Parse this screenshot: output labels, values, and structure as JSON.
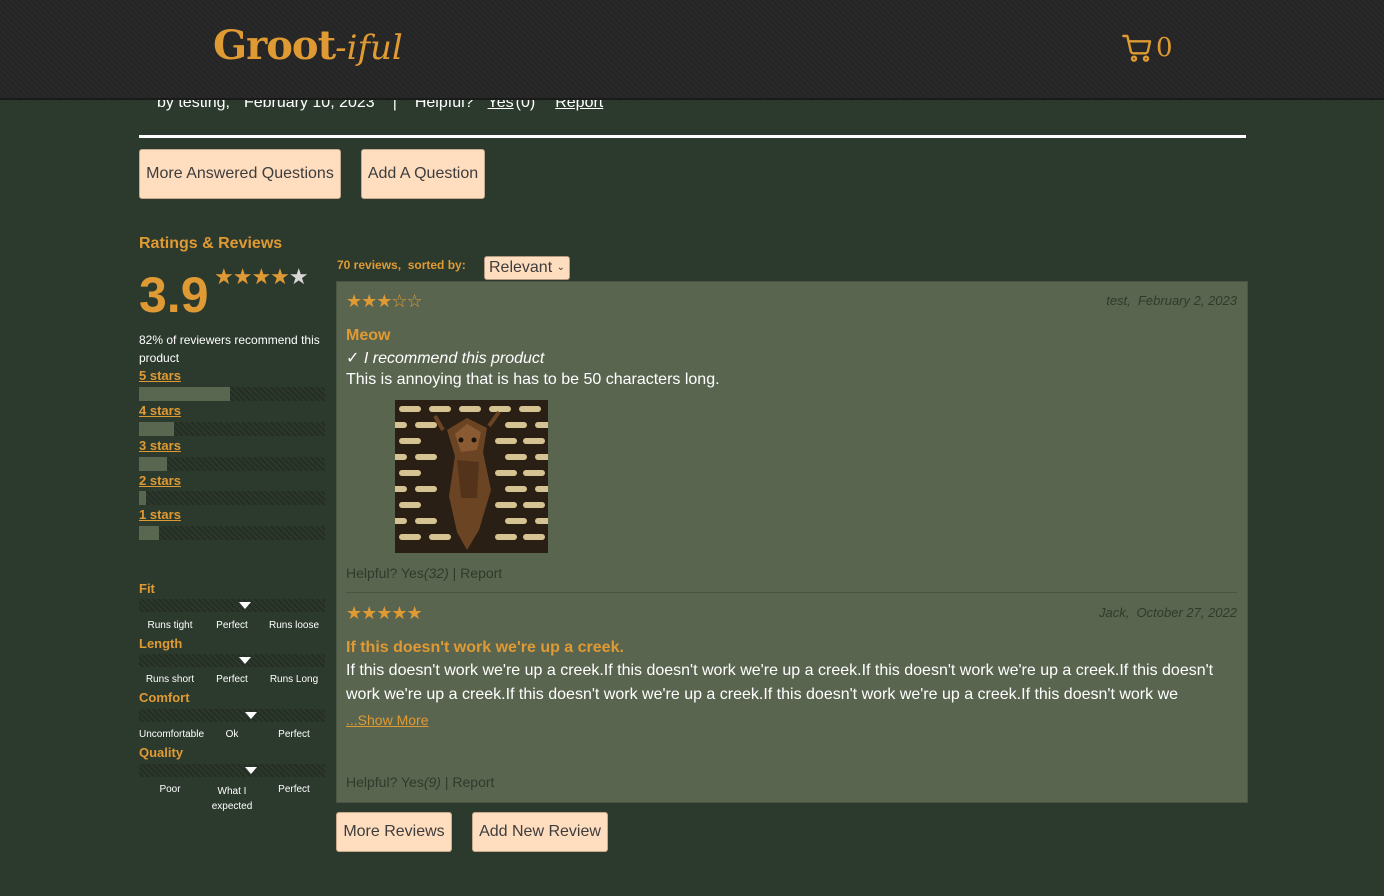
{
  "header": {
    "logo_main": "Groot",
    "logo_suffix": "-iful",
    "cart_count": "0"
  },
  "answer_meta": {
    "by": "by testing,",
    "date": "February 10, 2023",
    "sep": "|",
    "helpful": "Helpful?",
    "yes": "Yes",
    "yes_count": "(0)",
    "report": "Report"
  },
  "qa_buttons": {
    "more_questions": "More Answered Questions",
    "add_question": "Add A Question"
  },
  "ratings": {
    "heading": "Ratings & Reviews",
    "average": "3.9",
    "average_stars": "★★★★",
    "average_star_empty": "★",
    "recommend": "82% of reviewers recommend this product",
    "breakdown": [
      {
        "label": "5 stars",
        "fraction": 0.49
      },
      {
        "label": "4 stars",
        "fraction": 0.19
      },
      {
        "label": "3 stars",
        "fraction": 0.15
      },
      {
        "label": "2 stars",
        "fraction": 0.04
      },
      {
        "label": "1 stars",
        "fraction": 0.11
      }
    ]
  },
  "characteristics": [
    {
      "name": "Fit",
      "value": 0.57,
      "scale": [
        "Runs tight",
        "Perfect",
        "Runs loose"
      ]
    },
    {
      "name": "Length",
      "value": 0.57,
      "scale": [
        "Runs short",
        "Perfect",
        "Runs Long"
      ]
    },
    {
      "name": "Comfort",
      "value": 0.6,
      "scale": [
        "Uncomfortable",
        "Ok",
        "Perfect"
      ]
    },
    {
      "name": "Quality",
      "value": 0.6,
      "scale": [
        "Poor",
        "What I expected",
        "Perfect"
      ]
    }
  ],
  "reviews_list": {
    "count_text": "70 reviews,  sorted by:",
    "sort_selected": "Relevant",
    "reviews": [
      {
        "stars": "★★★☆☆",
        "meta": "test,  February 2, 2023",
        "title": "Meow",
        "recommend": "✓ I recommend this product",
        "body": "This is annoying that is has to be 50 characters long.",
        "helpful": "Helpful? Yes",
        "helpful_count": "(32)",
        "report": " | Report"
      },
      {
        "stars": "★★★★★",
        "meta": "Jack,  October 27, 2022",
        "title": "If this doesn't work we're up a creek.",
        "body": "If this doesn't work we're up a creek.If this doesn't work we're up a creek.If this doesn't work we're up a creek.If this doesn't work we're up a creek.If this doesn't work we're up a creek.If this doesn't work we're up a creek.If this doesn't work we",
        "show_more": "...Show More",
        "helpful": "Helpful? Yes",
        "helpful_count": "(9)",
        "report": " | Report"
      }
    ]
  },
  "review_buttons": {
    "more_reviews": "More Reviews",
    "add_review": "Add New Review"
  },
  "colors": {
    "accent": "#e09a33",
    "background": "#2c3a2e",
    "button_bg": "#ffddbf",
    "panel": "#5a6550"
  }
}
